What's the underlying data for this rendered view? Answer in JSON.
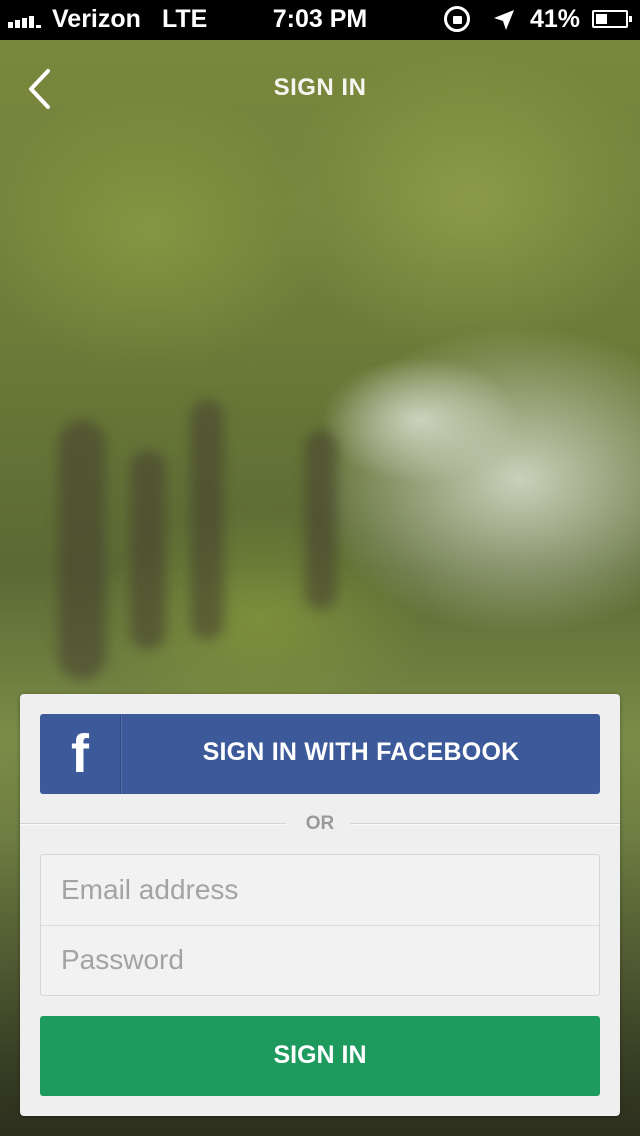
{
  "status_bar": {
    "carrier": "Verizon",
    "network": "LTE",
    "time": "7:03 PM",
    "battery_percent": "41%",
    "battery_level": 0.41,
    "icons": [
      "signal-bars-icon",
      "rotation-lock-icon",
      "location-arrow-icon",
      "battery-icon"
    ]
  },
  "nav": {
    "title": "SIGN IN",
    "back_icon": "chevron-left-icon"
  },
  "login_card": {
    "facebook_button": {
      "icon_glyph": "f",
      "label": "SIGN IN WITH FACEBOOK"
    },
    "separator_text": "OR",
    "email_field": {
      "placeholder": "Email address",
      "value": ""
    },
    "password_field": {
      "placeholder": "Password",
      "value": ""
    },
    "submit_label": "SIGN IN"
  },
  "colors": {
    "facebook_blue": "#3c5a9a",
    "sign_in_green": "#1e9a5e",
    "card_background": "#efefef",
    "placeholder_gray": "#a3a3a3"
  }
}
